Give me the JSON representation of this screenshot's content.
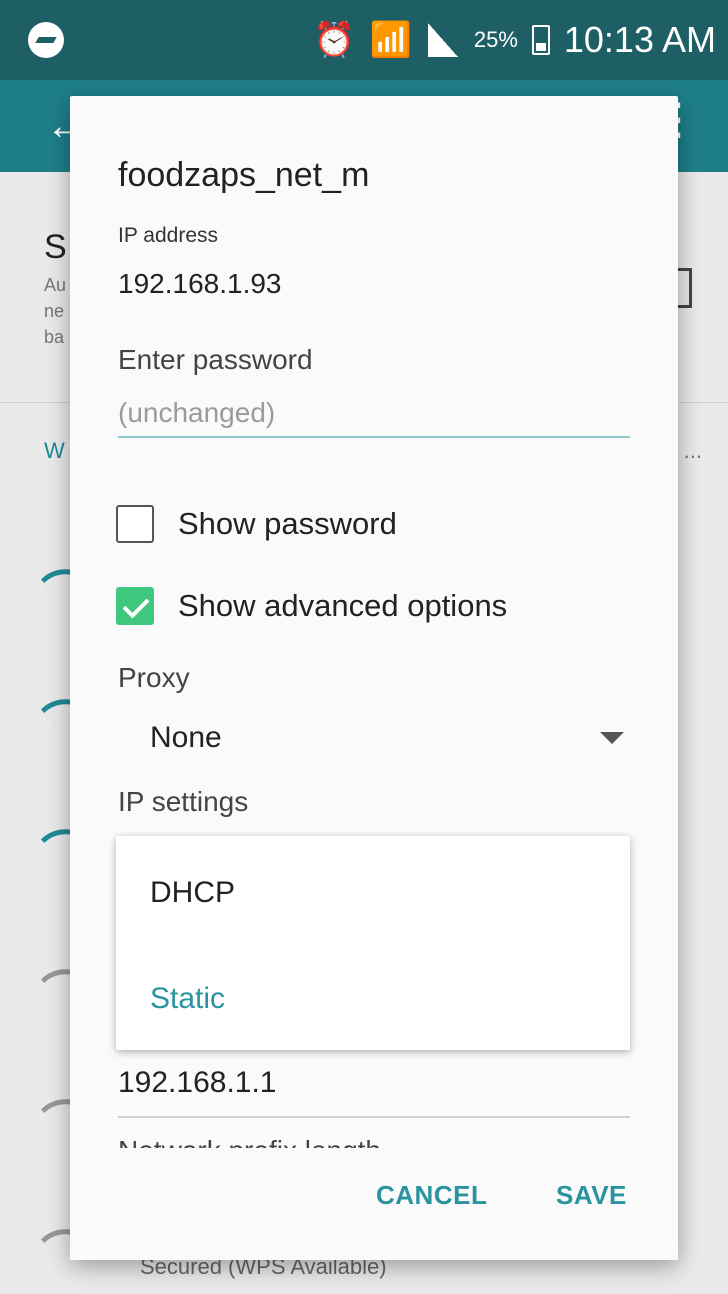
{
  "status_bar": {
    "battery_percent": "25%",
    "time": "10:13 AM",
    "icons": [
      "messenger-icon",
      "alarm-icon",
      "wifi-icon",
      "signal-icon",
      "battery-icon"
    ]
  },
  "background": {
    "title_fragment": "S",
    "sub_fragments": [
      "Au",
      "ne",
      "ba"
    ],
    "section_fragment": "W",
    "section_more": "...",
    "footer_fragment": "Secured (WPS Available)"
  },
  "dialog": {
    "title": "foodzaps_net_m",
    "ip_address_label": "IP address",
    "ip_address_value": "192.168.1.93",
    "password_label": "Enter password",
    "password_placeholder": "(unchanged)",
    "show_password_label": "Show password",
    "show_password_checked": false,
    "show_advanced_label": "Show advanced options",
    "show_advanced_checked": true,
    "proxy_label": "Proxy",
    "proxy_value": "None",
    "ip_settings_label": "IP settings",
    "ip_settings_options": [
      {
        "label": "DHCP",
        "selected": false
      },
      {
        "label": "Static",
        "selected": true
      }
    ],
    "gateway_value": "192.168.1.1",
    "prefix_label": "Network prefix length",
    "cancel_label": "CANCEL",
    "save_label": "SAVE"
  },
  "colors": {
    "status_bar": "#1e5f66",
    "app_bar": "#1e7f8a",
    "accent": "#2a93a0",
    "checkbox_checked": "#3ec77d"
  }
}
